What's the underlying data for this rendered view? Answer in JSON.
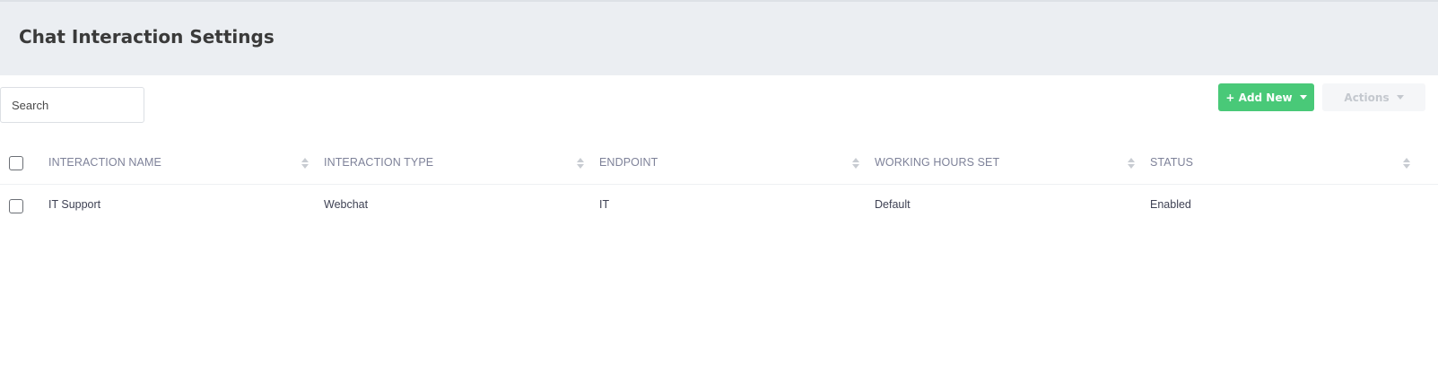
{
  "header": {
    "title": "Chat Interaction Settings"
  },
  "toolbar": {
    "search_placeholder": "Search",
    "add_new_label": "+ Add New",
    "actions_label": "Actions"
  },
  "colors": {
    "header_bg": "#ebeef2",
    "add_button": "#49c978",
    "actions_button_disabled": "#f5f6f8",
    "column_header_text": "#7e8299"
  },
  "table": {
    "columns": [
      "INTERACTION NAME",
      "INTERACTION TYPE",
      "ENDPOINT",
      "WORKING HOURS SET",
      "STATUS"
    ],
    "rows": [
      [
        "IT Support",
        "Webchat",
        "IT",
        "Default",
        "Enabled"
      ]
    ]
  }
}
